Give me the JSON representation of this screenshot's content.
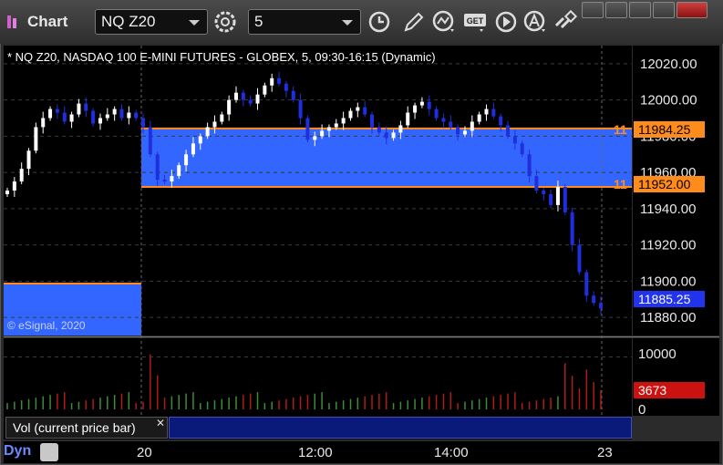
{
  "app": {
    "title": "Chart"
  },
  "toolbar": {
    "symbol": "NQ Z20",
    "interval": "5",
    "buttons": [
      "settings-gear",
      "clock",
      "pencil-draw",
      "studies",
      "get-data",
      "play",
      "text-annotation",
      "link"
    ]
  },
  "chart": {
    "header": "* NQ Z20, NASDAQ 100 E-MINI FUTURES - GLOBEX, 5, 09:30-16:15 (Dynamic)",
    "copyright": "© eSignal, 2020",
    "price_labels": [
      "12020.00",
      "12000.00",
      "11980.00",
      "11960.00",
      "11940.00",
      "11920.00",
      "11900.00",
      "11880.00"
    ],
    "last_price": "11885.25",
    "level_high": {
      "label": "11984.25",
      "left_tag": "11"
    },
    "level_low": {
      "label": "11952.00",
      "left_tag": "11"
    },
    "colors": {
      "zone": "#3366ff",
      "level": "#ff8c1a",
      "up": "#ffffff",
      "down": "#1f2fe0",
      "last_price": "#2233ee",
      "vol_last": "#cc1111"
    }
  },
  "volume": {
    "legend": "Vol (current price bar)",
    "labels": [
      "10000",
      "0"
    ],
    "last_volume": "3673"
  },
  "time_axis": {
    "labels": [
      "20",
      "12:00",
      "14:00",
      "23"
    ]
  },
  "footer": {
    "mode": "Dyn"
  },
  "chart_data": {
    "type": "candlestick",
    "title": "* NQ Z20, NASDAQ 100 E-MINI FUTURES - GLOBEX, 5, 09:30-16:15 (Dynamic)",
    "ylim": [
      11870,
      12030
    ],
    "closes": [
      11950,
      11955,
      11962,
      11972,
      11985,
      11990,
      11995,
      11993,
      11988,
      11992,
      11998,
      11994,
      11987,
      11990,
      11992,
      11995,
      11990,
      11993,
      11990,
      11985,
      11970,
      11956,
      11955,
      11958,
      11964,
      11970,
      11976,
      11980,
      11985,
      11988,
      11992,
      12000,
      12004,
      12000,
      11998,
      12003,
      12008,
      12012,
      12009,
      12005,
      12000,
      11990,
      11978,
      11980,
      11983,
      11985,
      11987,
      11990,
      11994,
      11996,
      11992,
      11985,
      11982,
      11979,
      11982,
      11986,
      11993,
      11997,
      11999,
      11995,
      11990,
      11988,
      11985,
      11981,
      11983,
      11988,
      11992,
      11995,
      11991,
      11986,
      11980,
      11976,
      11970,
      11958,
      11950,
      11948,
      11942,
      11952,
      11938,
      11920,
      11905,
      11892,
      11888,
      11885
    ],
    "volume_ylim": [
      0,
      12000
    ],
    "levels": [
      11984.25,
      11952.0
    ],
    "last": 11885.25,
    "last_volume": 3673
  }
}
